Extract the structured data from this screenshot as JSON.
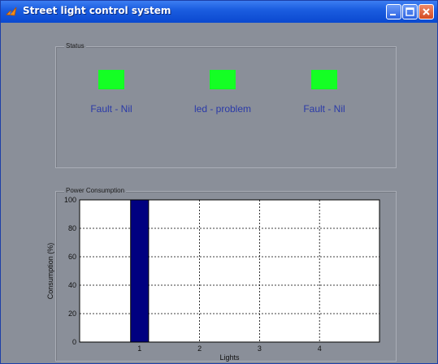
{
  "window": {
    "title": "Street light control system"
  },
  "status_panel": {
    "title": "Status",
    "indicators": [
      {
        "label": "Fault - Nil",
        "color": "#14ff24"
      },
      {
        "label": "led - problem",
        "color": "#14ff24"
      },
      {
        "label": "Fault - Nil",
        "color": "#14ff24"
      }
    ]
  },
  "power_panel": {
    "title": "Power Consumption"
  },
  "colors": {
    "titlebar": "#0a49d0",
    "background": "#8a8f99",
    "indicator_on": "#14ff24",
    "label_text": "#2a3aa8",
    "bar": "#000080"
  },
  "icons": {
    "app": "matlab-logo-icon",
    "minimize": "minimize-icon",
    "maximize": "maximize-icon",
    "close": "close-icon"
  },
  "chart_data": {
    "type": "bar",
    "categories": [
      "1",
      "2",
      "3",
      "4"
    ],
    "values": [
      100,
      0,
      0,
      0
    ],
    "title": "",
    "xlabel": "Lights",
    "ylabel": "Consumption (%)",
    "ylim": [
      0,
      100
    ],
    "xlim": [
      0,
      5
    ],
    "yticks": [
      "0",
      "20",
      "40",
      "60",
      "80",
      "100"
    ],
    "grid": true,
    "bar_color": "#000080"
  }
}
